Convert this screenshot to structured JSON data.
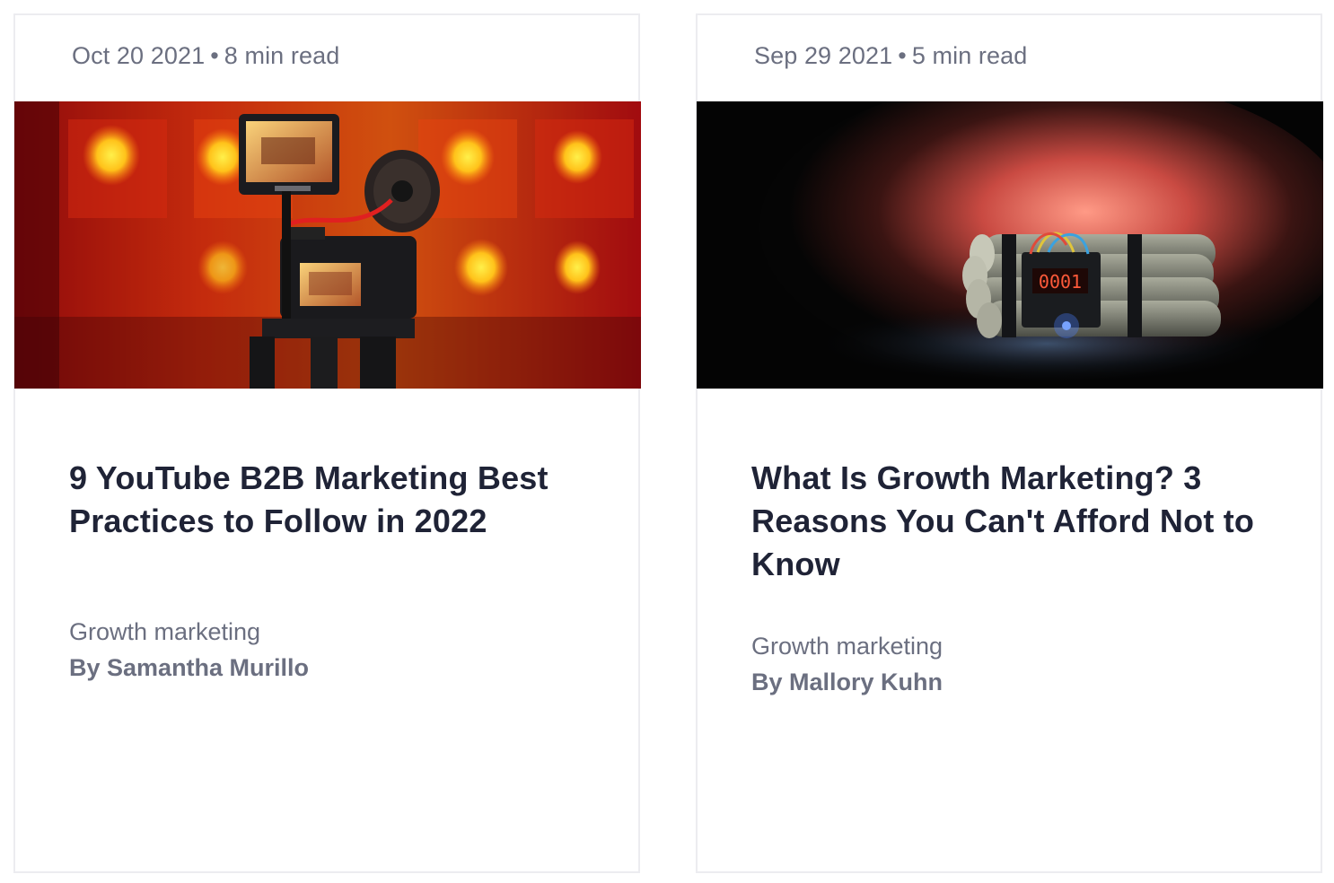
{
  "cards": [
    {
      "date": "Oct 20 2021",
      "separator": "•",
      "read_time": "8 min read",
      "title": "9 YouTube B2B Marketing Best Practices to Follow in 2022",
      "category": "Growth marketing",
      "author": "By Samantha Murillo",
      "image": "camera-rig-photo"
    },
    {
      "date": "Sep 29 2021",
      "separator": "•",
      "read_time": "5 min read",
      "title": "What Is Growth Marketing? 3 Reasons You Can't Afford Not to Know",
      "category": "Growth marketing",
      "author": "By Mallory Kuhn",
      "image": "time-bomb-photo",
      "timer_display": "0001"
    }
  ],
  "colors": {
    "meta_text": "#6b6f80",
    "title_text": "#1f2336",
    "card_border": "#ececf0"
  }
}
